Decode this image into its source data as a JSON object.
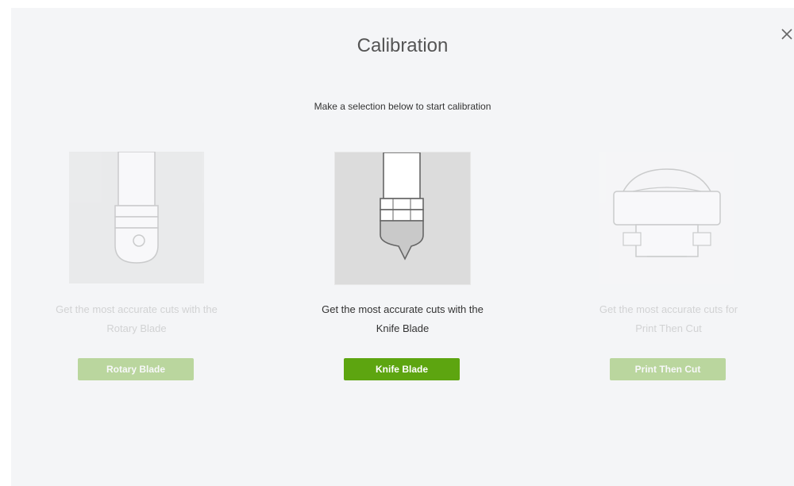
{
  "dialog": {
    "title": "Calibration",
    "subtitle": "Make a selection below to start calibration",
    "close_icon": "close-icon"
  },
  "options": [
    {
      "description_line1": "Get the most accurate cuts with the",
      "description_line2": "Rotary Blade",
      "button_label": "Rotary Blade",
      "selected": false,
      "icon": "rotary-blade-icon"
    },
    {
      "description_line1": "Get the most accurate cuts with the",
      "description_line2": "Knife Blade",
      "button_label": "Knife Blade",
      "selected": true,
      "icon": "knife-blade-icon"
    },
    {
      "description_line1": "Get the most accurate cuts for",
      "description_line2": "Print Then Cut",
      "button_label": "Print Then Cut",
      "selected": false,
      "icon": "printer-icon"
    }
  ],
  "colors": {
    "accent": "#5da510",
    "background": "#f4f5f7",
    "image_bg": "#dcdcdc"
  }
}
